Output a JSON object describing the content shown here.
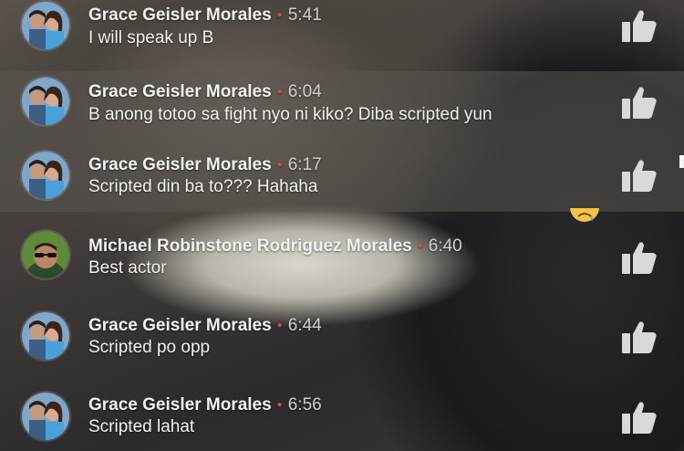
{
  "comments": [
    {
      "name": "Grace Geisler Morales",
      "time": "5:41",
      "text": "I will speak up B",
      "avatar": "couple-avatar",
      "highlight": false
    },
    {
      "name": "Grace Geisler Morales",
      "time": "6:04",
      "text": "B anong totoo sa fight nyo ni kiko? Diba scripted yun",
      "avatar": "couple-avatar",
      "highlight": true
    },
    {
      "name": "Grace Geisler Morales",
      "time": "6:17",
      "text": "Scripted din ba to??? Hahaha",
      "avatar": "couple-avatar",
      "highlight": true
    },
    {
      "name": "Michael Robinstone Rodriguez Morales",
      "time": "6:40",
      "text": "Best actor",
      "avatar": "man-sunglasses-avatar",
      "highlight": false
    },
    {
      "name": "Grace Geisler Morales",
      "time": "6:44",
      "text": "Scripted po opp",
      "avatar": "couple-avatar",
      "highlight": false
    },
    {
      "name": "Grace Geisler Morales",
      "time": "6:56",
      "text": "Scripted lahat",
      "avatar": "couple-avatar",
      "highlight": false
    }
  ],
  "icons": {
    "like": "thumbs-up-icon",
    "reaction": "sad-emoji-icon"
  },
  "colors": {
    "separator_dot": "#e0463c",
    "text": "#f2f2f2"
  }
}
